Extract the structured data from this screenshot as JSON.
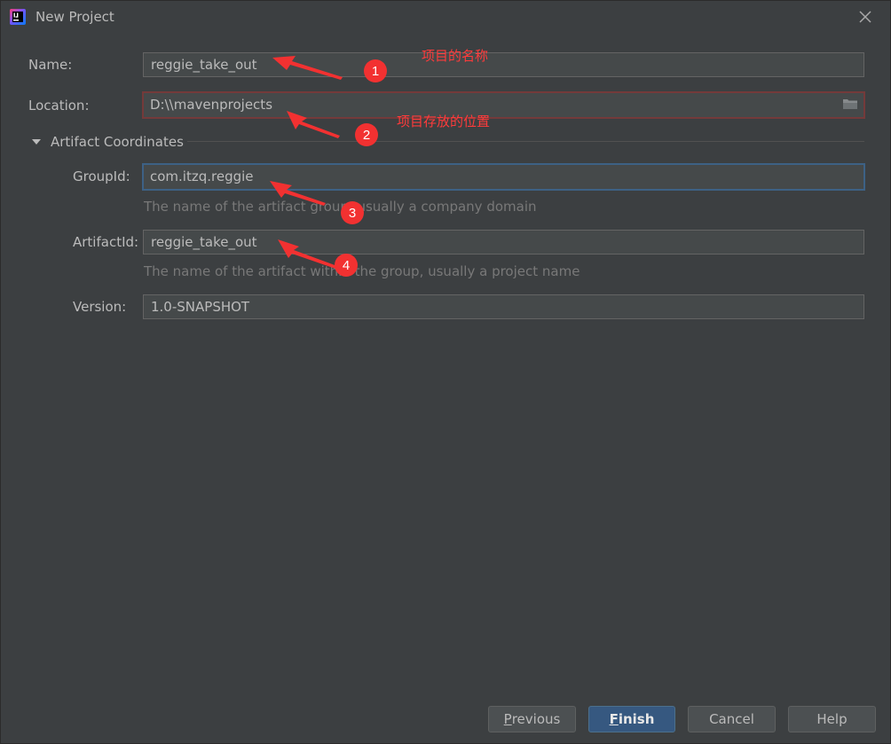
{
  "window": {
    "title": "New Project"
  },
  "form": {
    "name_label": "Name:",
    "name_value": "reggie_take_out",
    "location_label": "Location:",
    "location_value": "D:\\\\mavenprojects",
    "section_title": "Artifact Coordinates",
    "groupid_label": "GroupId:",
    "groupid_value": "com.itzq.reggie",
    "groupid_hint": "The name of the artifact group, usually a company domain",
    "artifactid_label": "ArtifactId:",
    "artifactid_value": "reggie_take_out",
    "artifactid_hint": "The name of the artifact within the group, usually a project name",
    "version_label": "Version:",
    "version_value": "1.0-SNAPSHOT"
  },
  "annotations": {
    "note_1": "项目的名称",
    "note_2": "项目存放的位置",
    "badges": [
      "1",
      "2",
      "3",
      "4"
    ],
    "color": "#f23131"
  },
  "buttons": {
    "previous_mnemonic": "P",
    "previous_rest": "revious",
    "finish_mnemonic": "F",
    "finish_rest": "inish",
    "cancel": "Cancel",
    "help": "Help"
  },
  "icons": {
    "app": "intellij-idea-icon",
    "close": "close-icon",
    "folder": "folder-icon",
    "expand": "triangle-down-icon"
  },
  "colors": {
    "background": "#3c3f41",
    "field_bg": "#45494a",
    "focus_border": "#3d6185",
    "error_border": "#743a3a",
    "primary_button": "#365880"
  }
}
